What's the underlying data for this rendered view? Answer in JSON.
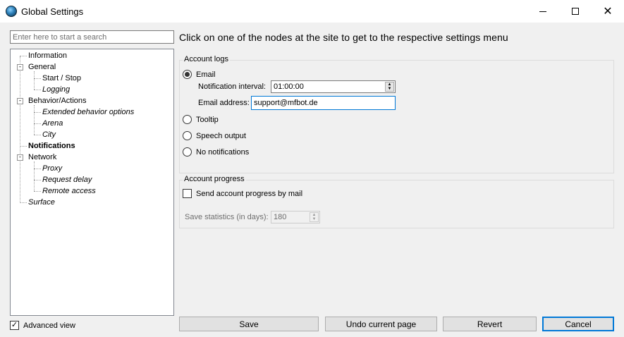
{
  "window": {
    "title": "Global Settings"
  },
  "search": {
    "placeholder": "Enter here to start a search",
    "value": ""
  },
  "instruction": "Click on one of the nodes at the site to get to the respective settings menu",
  "tree": {
    "information": "Information",
    "general": "General",
    "start_stop": "Start / Stop",
    "logging": "Logging",
    "behavior_actions": "Behavior/Actions",
    "extended_behavior": "Extended behavior options",
    "arena": "Arena",
    "city": "City",
    "notifications": "Notifications",
    "network": "Network",
    "proxy": "Proxy",
    "request_delay": "Request delay",
    "remote_access": "Remote access",
    "surface": "Surface",
    "selected": "Notifications"
  },
  "account_logs": {
    "title": "Account logs",
    "email_label": "Email",
    "selected_option": "Email",
    "interval_label": "Notification interval:",
    "interval_value": "01:00:00",
    "address_label": "Email address:",
    "address_value": "support@mfbot.de",
    "tooltip_label": "Tooltip",
    "speech_label": "Speech output",
    "none_label": "No notifications"
  },
  "account_progress": {
    "title": "Account progress",
    "send_label": "Send account progress by mail",
    "send_checked": false,
    "save_stats_label": "Save statistics (in days):",
    "save_stats_value": "180"
  },
  "footer": {
    "advanced_view_label": "Advanced view",
    "advanced_view_checked": true,
    "save": "Save",
    "undo": "Undo current page",
    "revert": "Revert",
    "cancel": "Cancel"
  }
}
